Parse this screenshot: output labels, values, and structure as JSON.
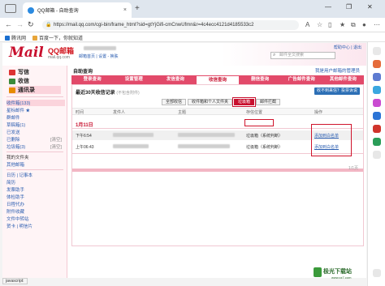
{
  "browser": {
    "tab_title": "QQ邮箱 - 自助查询",
    "tab_close": "×",
    "new_tab": "+",
    "url": "https://mail.qq.com/cgi-bin/frame_html?sid=gtYjGifi-cmCnwUfmn&r=4c4ecc4121d4185533c2",
    "fav_items": [
      "腾讯网",
      "百度一下，你就知道"
    ],
    "win_controls": [
      "—",
      "❐",
      "✕"
    ]
  },
  "mail": {
    "logo": "Mail",
    "logo_brand": "QQ邮箱",
    "logo_domain": "mail.qq.com",
    "user_links": "邮箱首页 | 设置 - 换肤",
    "search_placeholder": "邮件全文搜索",
    "top_links": "帮助中心 | 退出"
  },
  "sidebar": {
    "write": "写信",
    "receive": "收信",
    "contacts": "通讯录",
    "folders": [
      {
        "label": "收件箱(133)",
        "right": ""
      },
      {
        "label": "星标邮件 ★",
        "right": ""
      },
      {
        "label": "群邮件",
        "right": ""
      },
      {
        "label": "草稿箱(1)",
        "right": ""
      },
      {
        "label": "已发送",
        "right": ""
      },
      {
        "label": "已删除",
        "right": "[清空]"
      },
      {
        "label": "垃圾箱(3)",
        "right": "[清空]"
      }
    ],
    "my_folders": "我的文件夹",
    "other": "其他邮箱",
    "apps": [
      {
        "label": "日历 | 记事本"
      },
      {
        "label": "简历"
      },
      {
        "label": "发票助手"
      },
      {
        "label": "体检助手"
      },
      {
        "label": "日程代办"
      },
      {
        "label": "附件收藏"
      },
      {
        "label": "文件中转站"
      },
      {
        "label": "贺卡 | 明信片"
      }
    ]
  },
  "main": {
    "title": "自助查询",
    "right_link": "我是用户邮箱的管理员",
    "tabs": [
      "登录查询",
      "设置管理",
      "发信查询",
      "收信查询",
      "删信查询",
      "广告邮件查询",
      "其他邮件查询"
    ],
    "active_tab": 3,
    "panel_title": "最近30天收信记录",
    "panel_note": "(不包含附件)",
    "complain_btn": "收不到来信？投票诉说",
    "filters": [
      "全部收信",
      "收件箱和个人文件夹",
      "垃圾箱",
      "邮件拦截"
    ],
    "active_filter": 2,
    "columns": [
      "时间",
      "发件人",
      "主题",
      "存信位置",
      "操作"
    ],
    "date_group": "1月11日",
    "rows": [
      {
        "time": "下午6:54",
        "location": "垃圾箱（系统判断）",
        "action": "添加到白名单"
      },
      {
        "time": "上午06:43",
        "location": "垃圾箱（系统判断）",
        "action": "添加到白名单"
      }
    ],
    "pager": "1/1页"
  },
  "status": "javascript:",
  "watermark": {
    "title": "极光下载站",
    "url": "www.xz7.com"
  }
}
